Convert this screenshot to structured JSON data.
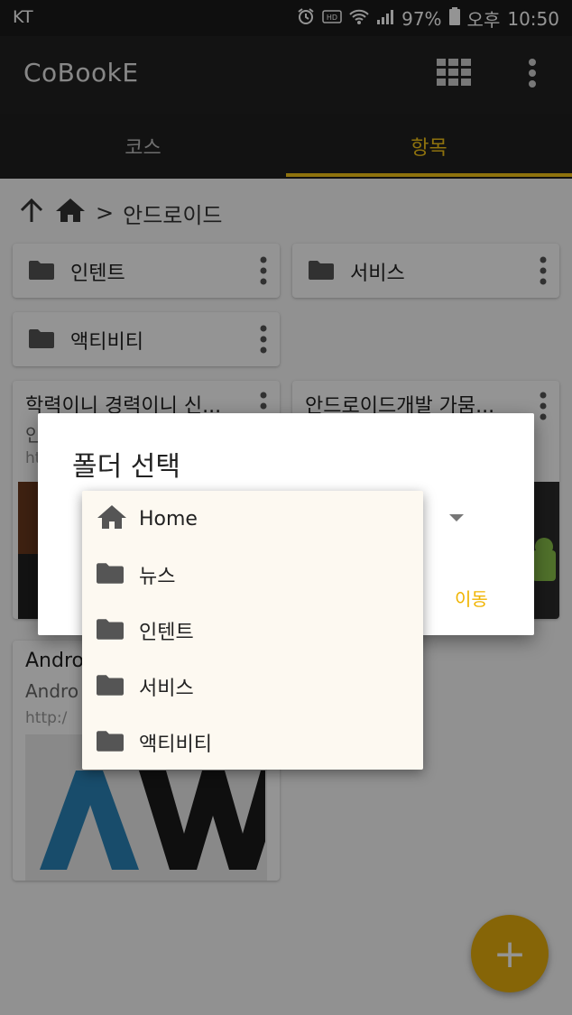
{
  "status_bar": {
    "carrier": "KT",
    "battery": "97%",
    "ampm": "오후",
    "time": "10:50"
  },
  "app_bar": {
    "title": "CoBookE"
  },
  "tabs": [
    {
      "label": "코스",
      "active": false
    },
    {
      "label": "항목",
      "active": true
    }
  ],
  "colors": {
    "accent": "#f5c518",
    "fab": "#e7ae0d",
    "move_text": "#f0b400"
  },
  "breadcrumb": {
    "separator": ">",
    "current": "안드로이드"
  },
  "folders": [
    {
      "label": "인텐트"
    },
    {
      "label": "서비스"
    },
    {
      "label": "액티비티"
    }
  ],
  "articles": [
    {
      "title": "학력이니 경력이니 신...",
      "sub": "인",
      "url": "ht"
    },
    {
      "title": "안드로이드개발 가뭄...",
      "sub": "",
      "url": ""
    },
    {
      "title": "Andro",
      "sub": "Andro",
      "url": "http:/"
    }
  ],
  "dialog": {
    "title": "폴더 선택",
    "move_label": "이동",
    "options": [
      {
        "label": "Home",
        "icon": "home-icon"
      },
      {
        "label": "뉴스",
        "icon": "folder-icon"
      },
      {
        "label": "인텐트",
        "icon": "folder-icon"
      },
      {
        "label": "서비스",
        "icon": "folder-icon"
      },
      {
        "label": "액티비티",
        "icon": "folder-icon"
      }
    ]
  },
  "fab": {
    "label": "+"
  }
}
